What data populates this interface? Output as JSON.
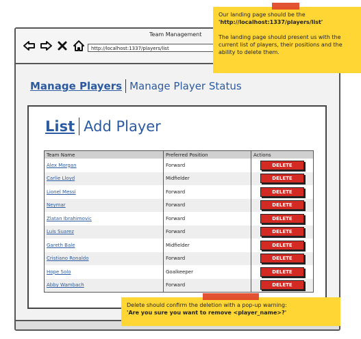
{
  "window": {
    "title": "Team Management",
    "url": "http://localhost:1337/players/list"
  },
  "nav_icons": [
    "back-arrow-icon",
    "forward-arrow-icon",
    "close-icon",
    "home-icon"
  ],
  "page_nav": {
    "manage_players": "Manage Players",
    "manage_player_status": "Manage Player Status"
  },
  "sub_nav": {
    "list": "List",
    "add_player": "Add Player"
  },
  "table": {
    "headers": [
      "Team Name",
      "Preferred Position",
      "Actions"
    ],
    "delete_label": "DELETE",
    "rows": [
      {
        "name": "Alex Morgan",
        "position": "Forward"
      },
      {
        "name": "Carlie Lloyd",
        "position": "Midfielder"
      },
      {
        "name": "Lionel Messi",
        "position": "Forward"
      },
      {
        "name": "Neymar",
        "position": "Forward"
      },
      {
        "name": "Zlatan Ibrahimovic",
        "position": "Forward"
      },
      {
        "name": "Luis Suarez",
        "position": "Forward"
      },
      {
        "name": "Gareth Bale",
        "position": "Midfielder"
      },
      {
        "name": "Cristiano Ronaldo",
        "position": "Forward"
      },
      {
        "name": "Hope Solo",
        "position": "Goalkeeper"
      },
      {
        "name": "Abby Wambach",
        "position": "Forward"
      }
    ]
  },
  "notes": {
    "top": {
      "line1": "Our landing page should be the",
      "line1_bold": "'http://localhost:1337/players/list'",
      "line2": "The landing page should present us with the current list of players, their positions and the ability to delete them."
    },
    "bottom": {
      "line1": "Delete should confirm the deletion with a pop-up warning:",
      "line2_bold": "'Are you sure you want to remove <player_name>?'"
    }
  },
  "colors": {
    "link": "#2b5aa0",
    "delete_button": "#d42a24",
    "sticky_note": "#ffd633",
    "tape": "#e04a2a"
  }
}
